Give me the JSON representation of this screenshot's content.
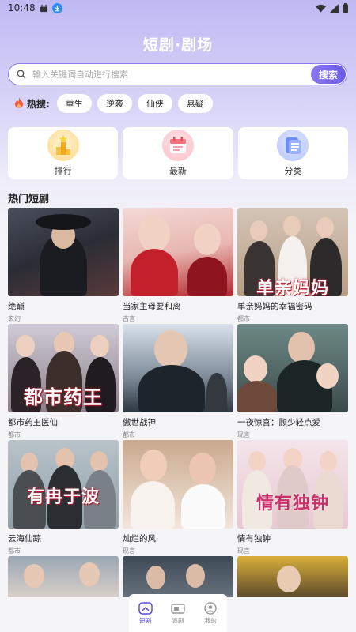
{
  "status_bar": {
    "time": "10:48"
  },
  "header": {
    "title": "短剧·剧场"
  },
  "search": {
    "placeholder": "输入关键词自动进行搜索",
    "button_label": "搜索"
  },
  "hot_search": {
    "label": "热搜:",
    "tags": [
      "重生",
      "逆袭",
      "仙侠",
      "悬疑"
    ]
  },
  "categories": [
    {
      "label": "排行",
      "icon": "trophy-icon"
    },
    {
      "label": "最新",
      "icon": "calendar-icon"
    },
    {
      "label": "分类",
      "icon": "category-icon"
    }
  ],
  "section": {
    "title": "热门短剧"
  },
  "dramas": [
    {
      "title": "绝巅",
      "genre": "玄幻"
    },
    {
      "title": "当家主母要和离",
      "genre": "古言"
    },
    {
      "title": "单亲妈妈的幸福密码",
      "genre": "都市",
      "poster_text": "单亲妈妈"
    },
    {
      "title": "都市药王医仙",
      "genre": "都市",
      "poster_text": "都市药王"
    },
    {
      "title": "傲世战神",
      "genre": "都市"
    },
    {
      "title": "一夜惊喜：顾少轻点爱",
      "genre": "现言"
    },
    {
      "title": "云海仙踪",
      "genre": "都市",
      "poster_text": "有冉于波"
    },
    {
      "title": "灿烂的风",
      "genre": "现言"
    },
    {
      "title": "情有独钟",
      "genre": "现言",
      "poster_text": "情有独钟"
    }
  ],
  "bottom_nav": [
    {
      "label": "短剧",
      "icon": "play-icon",
      "active": true
    },
    {
      "label": "追剧",
      "icon": "video-icon",
      "active": false
    },
    {
      "label": "我的",
      "icon": "profile-icon",
      "active": false
    }
  ],
  "colors": {
    "accent": "#6a59e6",
    "hot": "#f05a3a"
  }
}
